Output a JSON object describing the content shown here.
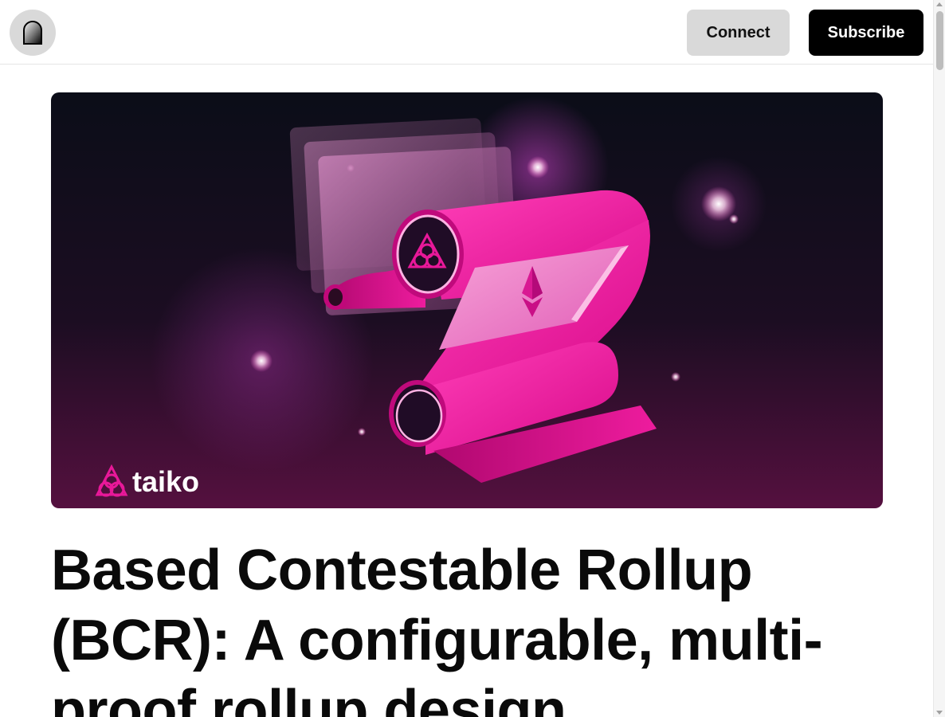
{
  "header": {
    "logo_icon": "arch-door-icon",
    "connect_label": "Connect",
    "subscribe_label": "Subscribe"
  },
  "hero": {
    "brand_text": "taiko",
    "brand_icon": "taiko-triangle-knot-icon",
    "colors": {
      "background_dark": "#0b0d18",
      "background_tint": "#5a0f45",
      "accent_pink": "#e81899"
    }
  },
  "article": {
    "title": "Based Contestable Rollup (BCR): A configurable, multi-proof rollup design"
  }
}
